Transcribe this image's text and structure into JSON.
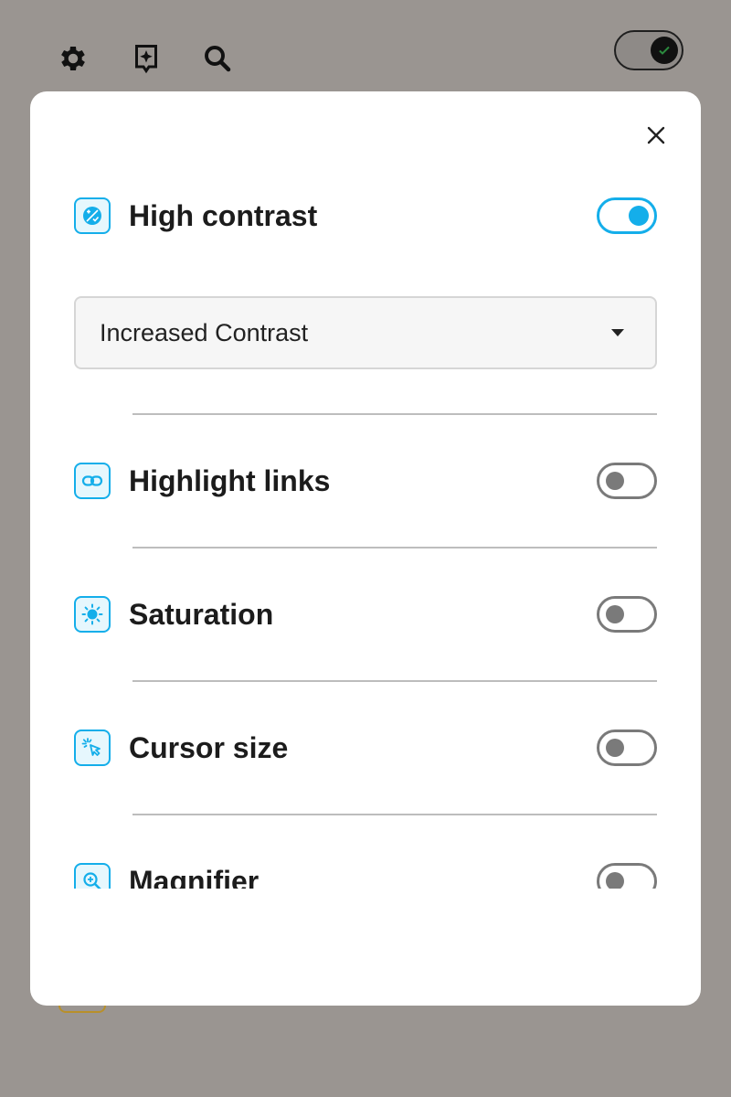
{
  "topbar": {
    "icons": [
      "gear-icon",
      "sparkle-badge-icon",
      "search-icon"
    ],
    "theme_toggle": {
      "state": "dark",
      "checked": true
    }
  },
  "modal": {
    "close_label": "",
    "high_contrast": {
      "label": "High contrast",
      "icon": "contrast-icon",
      "enabled": true,
      "mode_select": {
        "selected": "Increased Contrast"
      }
    },
    "features": [
      {
        "label": "Highlight links",
        "icon": "link-icon",
        "enabled": false
      },
      {
        "label": "Saturation",
        "icon": "sun-icon",
        "enabled": false
      },
      {
        "label": "Cursor size",
        "icon": "cursor-icon",
        "enabled": false
      },
      {
        "label": "Magnifier",
        "icon": "magnifier-icon",
        "enabled": false
      }
    ]
  },
  "colors": {
    "accent": "#14aeea",
    "overlay": "#9a9591",
    "switch_off": "#7a7a7a"
  }
}
